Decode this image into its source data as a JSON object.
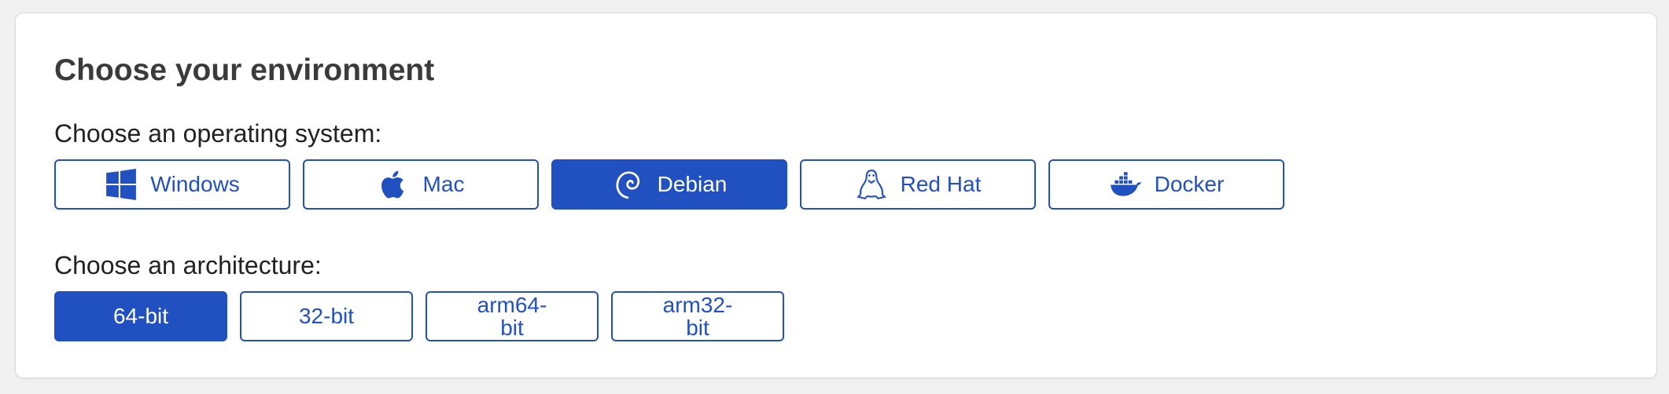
{
  "heading": "Choose your environment",
  "os_section": {
    "label": "Choose an operating system:",
    "options": [
      {
        "label": "Windows",
        "icon": "windows-icon",
        "selected": false
      },
      {
        "label": "Mac",
        "icon": "apple-icon",
        "selected": false
      },
      {
        "label": "Debian",
        "icon": "debian-icon",
        "selected": true
      },
      {
        "label": "Red Hat",
        "icon": "linux-tux-icon",
        "selected": false
      },
      {
        "label": "Docker",
        "icon": "docker-icon",
        "selected": false
      }
    ]
  },
  "arch_section": {
    "label": "Choose an architecture:",
    "options": [
      {
        "label": "64-bit",
        "selected": true
      },
      {
        "label": "32-bit",
        "selected": false
      },
      {
        "label": "arm64-bit",
        "selected": false
      },
      {
        "label": "arm32-bit",
        "selected": false
      }
    ]
  },
  "colors": {
    "accent": "#2150c0",
    "background": "#f1f1f1",
    "card": "#ffffff",
    "heading_text": "#3b3b3b"
  }
}
